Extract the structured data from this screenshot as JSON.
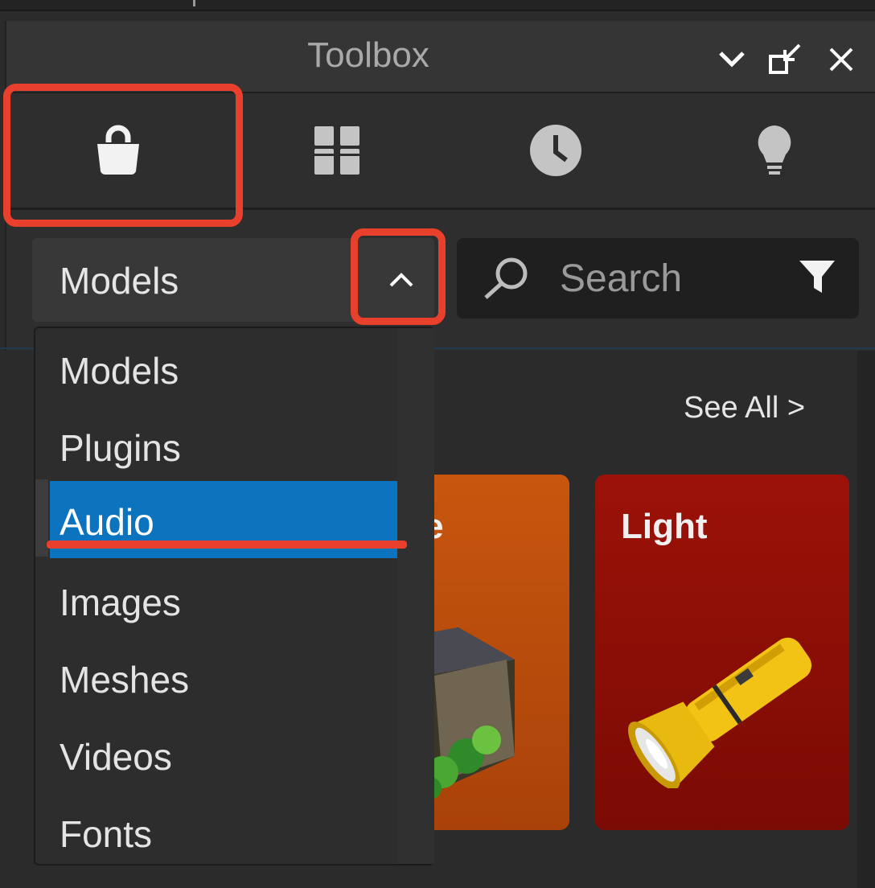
{
  "window": {
    "title": "Toolbox"
  },
  "tabs": [
    {
      "name": "marketplace",
      "icon": "shopping-bag-icon"
    },
    {
      "name": "inventory",
      "icon": "grid-icon"
    },
    {
      "name": "recent",
      "icon": "clock-icon"
    },
    {
      "name": "creations",
      "icon": "lightbulb-icon"
    }
  ],
  "category": {
    "selected": "Models",
    "options": [
      "Models",
      "Plugins",
      "Audio",
      "Images",
      "Meshes",
      "Videos",
      "Fonts"
    ],
    "highlighted": "Audio"
  },
  "search": {
    "placeholder": "Search",
    "value": ""
  },
  "content": {
    "see_all": "See All >",
    "cards": [
      {
        "label": "cture"
      },
      {
        "label": "Light"
      }
    ]
  },
  "colors": {
    "accent": "#0c73bf",
    "annotation": "#e8402c",
    "card_orange": "#c8560e",
    "card_red": "#9c1208"
  }
}
